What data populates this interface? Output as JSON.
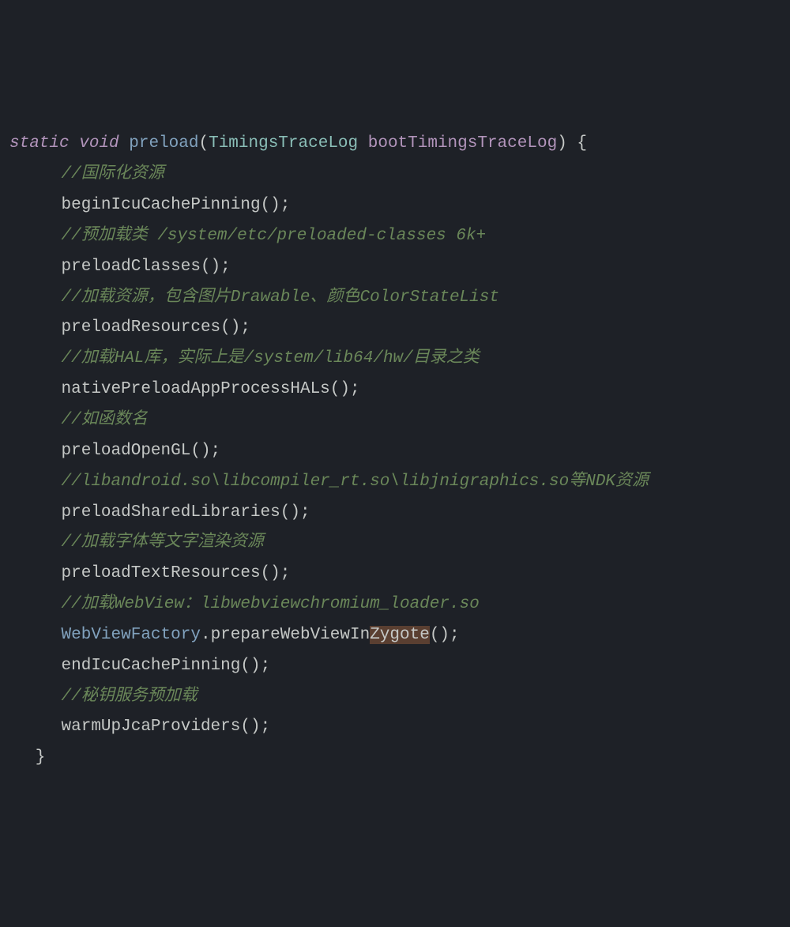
{
  "code": {
    "sig": {
      "static": "static",
      "void": "void",
      "fn": "preload",
      "lp": "(",
      "ptype": "TimingsTraceLog",
      "pname": "bootTimingsTraceLog",
      "rp_brace": ") {"
    },
    "lines": [
      {
        "t": "comment",
        "text": "//国际化资源"
      },
      {
        "t": "stmt",
        "call": "beginIcuCachePinning",
        "tail": "();"
      },
      {
        "t": "comment",
        "text": "//预加载类 /system/etc/preloaded-classes 6k+"
      },
      {
        "t": "stmt",
        "call": "preloadClasses",
        "tail": "();"
      },
      {
        "t": "comment",
        "text": "//加载资源，包含图片Drawable、颜色ColorStateList"
      },
      {
        "t": "stmt",
        "call": "preloadResources",
        "tail": "();"
      },
      {
        "t": "comment",
        "text": "//加载HAL库，实际上是/system/lib64/hw/目录之类"
      },
      {
        "t": "stmt",
        "call": "nativePreloadAppProcessHALs",
        "tail": "();"
      },
      {
        "t": "comment",
        "text": "//如函数名"
      },
      {
        "t": "stmt",
        "call": "preloadOpenGL",
        "tail": "();"
      },
      {
        "t": "comment",
        "text": "//libandroid.so\\libcompiler_rt.so\\libjnigraphics.so等NDK资源"
      },
      {
        "t": "stmt",
        "call": "preloadSharedLibraries",
        "tail": "();"
      },
      {
        "t": "comment",
        "text": "//加载字体等文字渲染资源"
      },
      {
        "t": "stmt",
        "call": "preloadTextResources",
        "tail": "();"
      },
      {
        "t": "comment",
        "text": "//加载WebView：libwebviewchromium_loader.so"
      },
      {
        "t": "stmt2",
        "cls": "WebViewFactory",
        "dot": ".",
        "pre": "prepareWebViewIn",
        "hl": "Zygote",
        "tail": "();"
      },
      {
        "t": "stmt",
        "call": "endIcuCachePinning",
        "tail": "();"
      },
      {
        "t": "comment",
        "text": "//秘钥服务预加载"
      },
      {
        "t": "stmt",
        "call": "warmUpJcaProviders",
        "tail": "();"
      }
    ],
    "close": "}"
  }
}
